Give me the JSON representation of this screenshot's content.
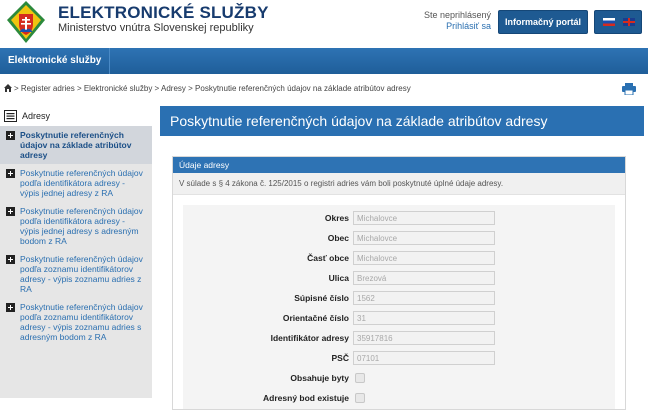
{
  "header": {
    "title": "ELEKTRONICKÉ SLUŽBY",
    "subtitle": "Ministerstvo vnútra Slovenskej republiky",
    "login_status": "Ste neprihlásený",
    "login_link": "Prihlásiť sa",
    "portal_button": "Informačný portál",
    "languages": [
      "sk-flag",
      "uk-flag"
    ]
  },
  "nav": {
    "items": [
      "Elektronické služby"
    ]
  },
  "breadcrumb": {
    "items": [
      "Register adries",
      "Elektronické služby",
      "Adresy",
      "Poskytnutie referenčných údajov na základe atribútov adresy"
    ],
    "separator": " > "
  },
  "sidebar": {
    "heading": "Adresy",
    "items": [
      {
        "label": "Poskytnutie referenčných údajov na základe atribútov adresy",
        "active": true
      },
      {
        "label": "Poskytnutie referenčných údajov podľa identifikátora adresy - výpis jednej adresy z RA",
        "active": false
      },
      {
        "label": "Poskytnutie referenčných údajov podľa identifikátora adresy - výpis jednej adresy s adresným bodom z RA",
        "active": false
      },
      {
        "label": "Poskytnutie referenčných údajov podľa zoznamu identifikátorov adresy - výpis zoznamu adries z RA",
        "active": false
      },
      {
        "label": "Poskytnutie referenčných údajov podľa zoznamu identifikátorov adresy - výpis zoznamu adries s adresným bodom z RA",
        "active": false
      }
    ]
  },
  "main": {
    "title": "Poskytnutie referenčných údajov na základe atribútov adresy",
    "panel": {
      "heading": "Údaje adresy",
      "note": "V súlade s § 4 zákona č. 125/2015 o registri adries vám boli poskytnuté úplné údaje adresy.",
      "fields": [
        {
          "label": "Okres",
          "value": "Michalovce"
        },
        {
          "label": "Obec",
          "value": "Michalovce"
        },
        {
          "label": "Časť obce",
          "value": "Michalovce"
        },
        {
          "label": "Ulica",
          "value": "Brezová"
        },
        {
          "label": "Súpisné číslo",
          "value": "1562"
        },
        {
          "label": "Orientačné číslo",
          "value": "31"
        },
        {
          "label": "Identifikátor adresy",
          "value": "35917816"
        },
        {
          "label": "PSČ",
          "value": "07101"
        }
      ],
      "checkboxes": [
        {
          "label": "Obsahuje byty",
          "checked": false
        },
        {
          "label": "Adresný bod existuje",
          "checked": false
        }
      ]
    }
  },
  "colors": {
    "brand_blue": "#2a70b2",
    "title_navy": "#173b6e",
    "link_blue": "#2a6fb0"
  }
}
